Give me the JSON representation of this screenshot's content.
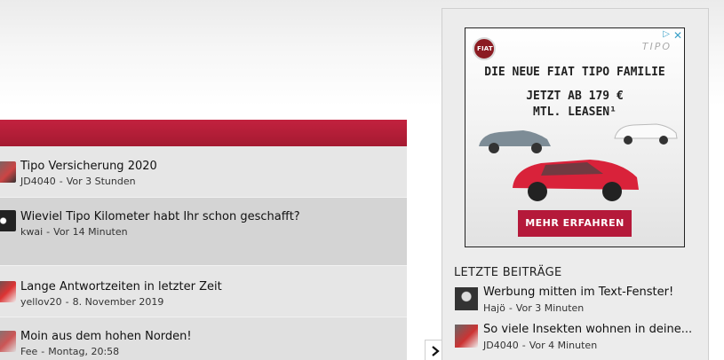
{
  "threads": [
    {
      "title": "Tipo Versicherung 2020",
      "author": "JD4040",
      "time": "Vor 3 Stunden"
    },
    {
      "title": "Wieviel Tipo Kilometer habt Ihr schon geschafft?",
      "author": "kwai",
      "time": "Vor 14 Minuten"
    },
    {
      "title": "Lange Antwortzeiten in letzter Zeit",
      "author": "yellov20",
      "time": "8. November 2019"
    },
    {
      "title": "Moin aus dem hohen Norden!",
      "author": "Fee",
      "time": "Montag, 20:58"
    }
  ],
  "ad": {
    "brand": "TIPO",
    "logo_text": "FIAT",
    "headline": "DIE NEUE FIAT TIPO FAMILIE",
    "price_line1": "JETZT AB 179 €",
    "price_line2": "MTL. LEASEN¹",
    "cta": "MEHR ERFAHREN",
    "close": "✕",
    "choice": "▷"
  },
  "recent": {
    "heading": "LETZTE BEITRÄGE",
    "items": [
      {
        "title": "Werbung mitten im Text-Fenster!",
        "author": "Hajö",
        "time": "Vor 3 Minuten"
      },
      {
        "title": "So viele Insekten wohnen in deine...",
        "author": "JD4040",
        "time": "Vor 4 Minuten"
      }
    ]
  },
  "separator": "-",
  "toggle_icon": "chevron-right-icon",
  "colors": {
    "accent": "#b5193a",
    "header": "#c3223f"
  }
}
